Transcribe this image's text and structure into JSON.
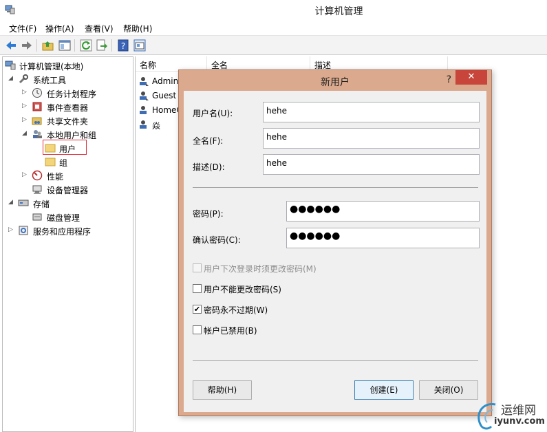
{
  "window": {
    "title": "计算机管理"
  },
  "menu": [
    "文件(F)",
    "操作(A)",
    "查看(V)",
    "帮助(H)"
  ],
  "toolbar": [
    "back-icon",
    "forward-icon",
    "up-folder-icon",
    "show-hide-tree-icon",
    "refresh-icon",
    "export-icon",
    "help-icon",
    "properties-icon"
  ],
  "tree": {
    "root": "计算机管理(本地)",
    "system_tools": "系统工具",
    "task_scheduler": "任务计划程序",
    "event_viewer": "事件查看器",
    "shared_folders": "共享文件夹",
    "local_users_groups": "本地用户和组",
    "users": "用户",
    "groups": "组",
    "performance": "性能",
    "device_manager": "设备管理器",
    "storage": "存储",
    "disk_management": "磁盘管理",
    "services_apps": "服务和应用程序"
  },
  "list": {
    "columns": [
      "名称",
      "全名",
      "描述"
    ],
    "rows": [
      "Admini",
      "Guest",
      "HomeG",
      "焱"
    ]
  },
  "dialog": {
    "title": "新用户",
    "help_glyph": "?",
    "close_glyph": "✕",
    "username_label": "用户名(U):",
    "username_value": "hehe",
    "fullname_label": "全名(F):",
    "fullname_value": "hehe",
    "desc_label": "描述(D):",
    "desc_value": "hehe",
    "password_label": "密码(P):",
    "password_value": "●●●●●●",
    "confirm_label": "确认密码(C):",
    "confirm_value": "●●●●●●",
    "chk_must_change": {
      "label": "用户下次登录时须更改密码(M)",
      "checked": false,
      "disabled": true
    },
    "chk_cannot_change": {
      "label": "用户不能更改密码(S)",
      "checked": false
    },
    "chk_never_expires": {
      "label": "密码永不过期(W)",
      "checked": true
    },
    "chk_disabled": {
      "label": "帐户已禁用(B)",
      "checked": false
    },
    "btn_help": "帮助(H)",
    "btn_create": "创建(E)",
    "btn_close": "关闭(O)"
  },
  "watermark": {
    "cn": "运维网",
    "en": "iyunv.com"
  },
  "colors": {
    "dialog_frame": "#dba98d",
    "close_button": "#c7453a",
    "selection_box": "#e0303a",
    "checkmark": "#000000"
  }
}
